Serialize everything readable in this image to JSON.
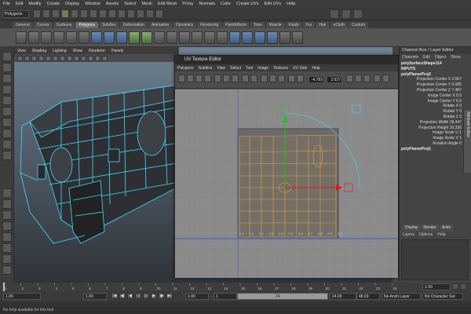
{
  "menubar": [
    "File",
    "Edit",
    "Modify",
    "Create",
    "Display",
    "Window",
    "Assets",
    "Select",
    "Mesh",
    "Edit Mesh",
    "Proxy",
    "Normals",
    "Color",
    "Create UVs",
    "Edit UVs",
    "Help"
  ],
  "mode_selector": "Polygons",
  "shelf_tabs": [
    "General",
    "Curves",
    "Surfaces",
    "Polygons",
    "Subdivs",
    "Deformation",
    "Animation",
    "Dynamics",
    "Rendering",
    "PaintEffects",
    "Toon",
    "Muscle",
    "Fluids",
    "Fur",
    "Hair",
    "nCloth",
    "Custom"
  ],
  "active_shelf_tab": "Polygons",
  "viewport_menu": [
    "View",
    "Shading",
    "Lighting",
    "Show",
    "Renderer",
    "Panels"
  ],
  "uv_editor": {
    "title": "UV Texture Editor",
    "menu": [
      "Polygons",
      "Subdivs",
      "View",
      "Select",
      "Tool",
      "Image",
      "Textures",
      "UV Sets",
      "Help"
    ],
    "field_u": "-4.783",
    "field_v": "2.627",
    "axis_labels": [
      "0.0",
      "0.1",
      "0.2",
      "0.3",
      "0.4",
      "0.5",
      "0.6",
      "0.7",
      "0.8",
      "0.9",
      "1.0"
    ]
  },
  "channel_box": {
    "title": "Channel Box / Layer Editor",
    "menu": [
      "Channels",
      "Edit",
      "Object",
      "Show"
    ],
    "lines": [
      {
        "text": "polySurfaceShape114",
        "kind": "head"
      },
      {
        "text": "INPUTS",
        "kind": "head"
      },
      {
        "text": "polyPlanarProj2",
        "kind": "head"
      },
      {
        "text": "Projection Center X 3.567",
        "kind": "attr"
      },
      {
        "text": "Projection Center Y 0.085",
        "kind": "attr"
      },
      {
        "text": "Projection Center Z 7.487",
        "kind": "attr"
      },
      {
        "text": "Image Center X 0.5",
        "kind": "attr"
      },
      {
        "text": "Image Center Y 0.5",
        "kind": "attr"
      },
      {
        "text": "Rotate X 0",
        "kind": "attr"
      },
      {
        "text": "Rotate Y 0",
        "kind": "attr"
      },
      {
        "text": "Rotate Z 0",
        "kind": "attr"
      },
      {
        "text": "Projection Width 29.447",
        "kind": "attr"
      },
      {
        "text": "Projection Height 10.336",
        "kind": "attr"
      },
      {
        "text": "Image Scale U 1",
        "kind": "attr"
      },
      {
        "text": "Image Scale V 1",
        "kind": "attr"
      },
      {
        "text": "Rotation Angle 0",
        "kind": "attr"
      },
      {
        "text": "polyPlanarProj1",
        "kind": "head"
      }
    ],
    "side_tab": "Attribute Editor",
    "layer_tabs": [
      "Display",
      "Render",
      "Anim"
    ],
    "layer_menu": [
      "Layers",
      "Options",
      "Help"
    ]
  },
  "time": {
    "ticks": [
      "1",
      "2",
      "3",
      "4",
      "5",
      "6",
      "7",
      "8",
      "9",
      "10",
      "11",
      "12",
      "13",
      "14",
      "15",
      "16",
      "17",
      "18",
      "19",
      "20",
      "21",
      "22",
      "23",
      "24"
    ],
    "current_frame": "1.00",
    "start_field": "1.00",
    "range_start": "1.00",
    "range_value": "1",
    "range_end_marker": "24",
    "end_field": "24.00",
    "end_field2": "48.00",
    "anim_layer": "No Anim Layer",
    "char_set": "No Character Set"
  },
  "help_line": "No help available for this tool",
  "colors": {
    "wire": "#46d7ff",
    "uv_orange": "#e8a040",
    "manip_green": "#19c319",
    "manip_red": "#e21818"
  }
}
